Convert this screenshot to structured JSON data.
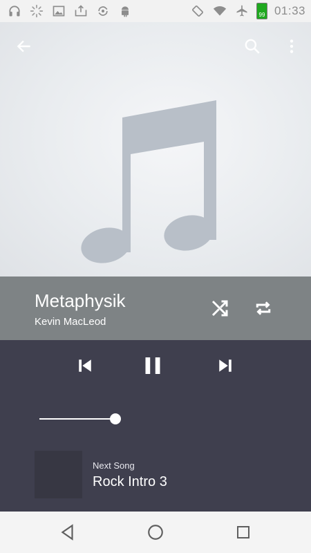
{
  "status_bar": {
    "time": "01:33",
    "battery_level": "99",
    "icons": [
      "headphones-icon",
      "loading-icon",
      "image-icon",
      "upload-icon",
      "sync-icon",
      "android-icon",
      "rotate-icon",
      "wifi-icon",
      "airplane-icon",
      "battery-icon"
    ]
  },
  "toolbar": {
    "back_icon": "arrow-left-icon",
    "search_icon": "search-icon",
    "menu_icon": "more-vert-icon"
  },
  "album_art": {
    "icon": "music-note-icon"
  },
  "now_playing": {
    "title": "Metaphysik",
    "artist": "Kevin MacLeod",
    "shuffle_icon": "shuffle-icon",
    "repeat_icon": "repeat-icon"
  },
  "controls": {
    "previous_icon": "skip-previous-icon",
    "pause_icon": "pause-icon",
    "next_icon": "skip-next-icon",
    "progress": 0.94
  },
  "up_next": {
    "label": "Next Song",
    "title": "Rock Intro 3"
  },
  "nav_bar": {
    "back_icon": "nav-back-icon",
    "home_icon": "nav-home-icon",
    "recents_icon": "nav-recents-icon"
  },
  "colors": {
    "info_bar": "#7e8385",
    "player_bg": "#3f3f4e",
    "status_bar": "#f2f2f2",
    "battery": "#1fa91f"
  }
}
